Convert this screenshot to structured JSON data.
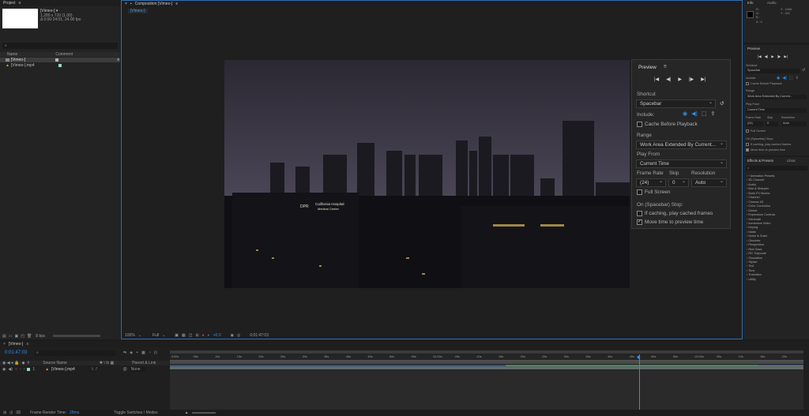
{
  "project": {
    "tab": "Project",
    "comp_name": "[Vimeo-] ▾",
    "comp_info1": "1,280 x 720 (1.00)",
    "comp_info2": "Δ 0:00:24:01, 24.00 fps",
    "search_placeholder": "",
    "columns": [
      "Name",
      "Comment"
    ],
    "items": [
      {
        "name": "[Vimeo-]",
        "type": "comp"
      },
      {
        "name": "[Vimeo-].mp4",
        "type": "footage"
      }
    ],
    "bpc": "8 bpc"
  },
  "composition": {
    "tab": "Composition [Vimeo-]",
    "subtab": "[Vimeo-]",
    "zoom": "100%",
    "quality": "Full",
    "exposure": "+0.0",
    "timecode": "0:01:47:03"
  },
  "preview_panel": {
    "title": "Preview",
    "shortcut_label": "Shortcut",
    "shortcut_value": "Spacebar",
    "include_label": "Include:",
    "cache_before": "Cache Before Playback",
    "range_label": "Range",
    "range_value": "Work Area Extended By Current...",
    "play_from_label": "Play From",
    "play_from_value": "Current Time",
    "frame_rate_label": "Frame Rate",
    "skip_label": "Skip",
    "resolution_label": "Resolution",
    "frame_rate_value": "(24)",
    "skip_value": "0",
    "resolution_value": "Auto",
    "full_screen": "Full Screen",
    "on_stop_label": "On (Spacebar) Stop:",
    "if_caching": "If caching, play cached frames",
    "move_time": "Move time to preview time",
    "move_time_checked": true
  },
  "right_info": {
    "tab1": "Info",
    "tab2": "Audio",
    "r": "R :",
    "g": "G :",
    "b": "B :",
    "a": "A : 0",
    "x": "X : 1006",
    "y": "Y : 421"
  },
  "right_preview": {
    "title": "Preview",
    "shortcut_label": "Shortcut",
    "shortcut_value": "Spacebar",
    "include_label": "Include:",
    "cache_before": "Cache Before Playback",
    "range_label": "Range",
    "range_value": "Work Area Extended By Current...",
    "play_from_label": "Play From",
    "play_from_value": "Current Time",
    "frame_rate_label": "Frame Rate",
    "skip_label": "Skip",
    "resolution_label": "Resolution",
    "frame_rate_value": "(24)",
    "skip_value": "0",
    "resolution_value": "Auto",
    "full_screen": "Full Screen",
    "on_stop_label": "On (Spacebar) Stop:",
    "if_caching": "If caching, play cached frames",
    "move_time": "Move time to preview time"
  },
  "effects": {
    "tab1": "Effects & Presets",
    "tab2": "Librar",
    "items": [
      "* Animation Presets",
      "3D Channel",
      "Audio",
      "Blur & Sharpen",
      "Boris FX Mocha",
      "Channel",
      "Cinema 4D",
      "Color Correction",
      "Distort",
      "Expression Controls",
      "Generate",
      "Immersive Video",
      "Keying",
      "Matte",
      "Noise & Grain",
      "Obsolete",
      "Perspective",
      "Red Giant",
      "RG Trapcode",
      "Simulation",
      "Stylize",
      "Text",
      "Time",
      "Transition",
      "Utility"
    ]
  },
  "timeline": {
    "tab": "[Vimeo-]",
    "timecode": "0:01:47:03",
    "columns": {
      "source": "Source Name",
      "parent": "Parent & Link"
    },
    "layer_num": "1",
    "layer_name": "[Vimeo-].mp4",
    "parent_value": "None",
    "ruler": [
      "0:00s",
      "05s",
      "10s",
      "15s",
      "20s",
      "25s",
      "30s",
      "35s",
      "40s",
      "45s",
      "50s",
      "55s",
      "01:00s",
      "05s",
      "10s",
      "15s",
      "20s",
      "25s",
      "30s",
      "35s",
      "40s",
      "45s",
      "50s",
      "55s",
      "02:00s",
      "05s",
      "10s",
      "15s",
      "20s"
    ],
    "footer_render": "Frame Render Time:",
    "footer_render_value": "28ms",
    "footer_toggle": "Toggle Switches / Modes"
  },
  "video": {
    "sign1": "California Hospital",
    "sign2": "Medical Center",
    "sign3": "DPR"
  },
  "colors": {
    "accent": "#2f8fe6",
    "timeline_green": "#3d8a55",
    "timeline_blue": "#2a4f8f"
  }
}
